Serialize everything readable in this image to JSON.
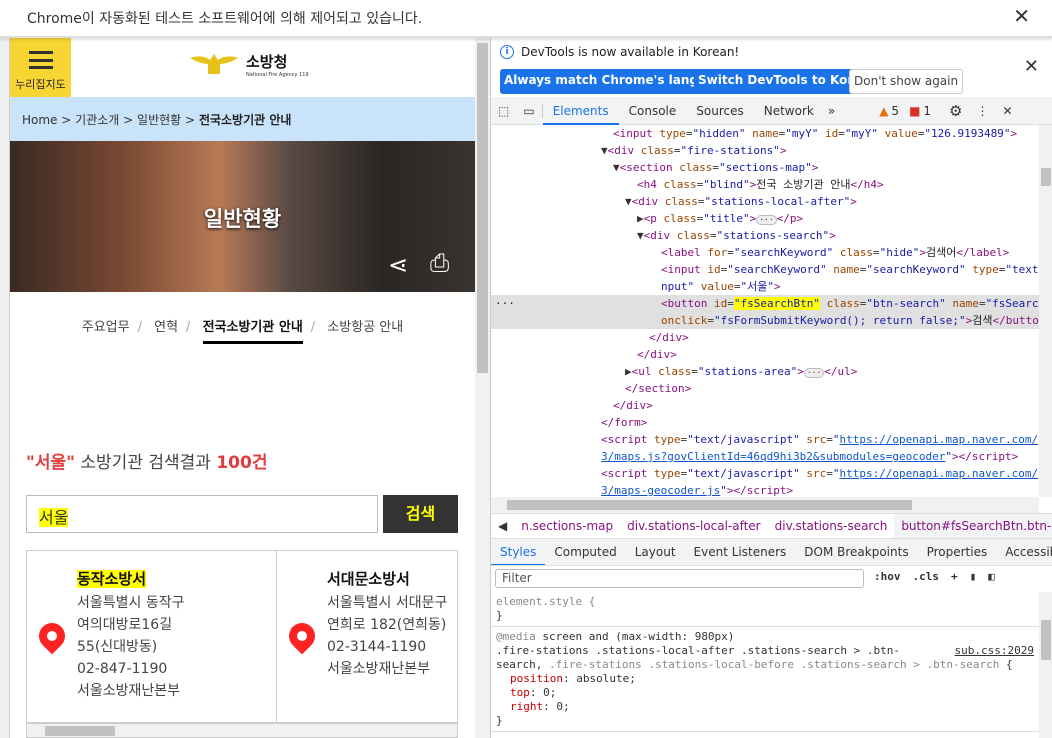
{
  "infobar": {
    "message": "Chrome이 자동화된 테스트 소프트웨어에 의해 제어되고 있습니다.",
    "close": "✕"
  },
  "page": {
    "menu_label": "누리집지도",
    "logo": {
      "name": "소방청",
      "subtitle": "National Fire Agency 119"
    },
    "breadcrumb": {
      "items": [
        "Home",
        "기관소개",
        "일반현황"
      ],
      "current": "전국소방기관 안내",
      "sep": ">"
    },
    "hero_title": "일반현황",
    "subnav": [
      "주요업무",
      "연혁",
      "전국소방기관 안내",
      "소방항공 안내"
    ],
    "result": {
      "query": "\"서울\"",
      "text": "소방기관 검색결과",
      "count": "100건"
    },
    "search": {
      "value": "서울",
      "button": "검색"
    },
    "stations": [
      {
        "name": "동작소방서",
        "lines": [
          "서울특별시 동작구",
          "여의대방로16길",
          "55(신대방동)",
          "02-847-1190",
          "서울소방재난본부"
        ]
      },
      {
        "name": "서대문소방서",
        "lines": [
          "서울특별시 서대문구",
          "연희로 182(연희동)",
          "02-3144-1190",
          "서울소방재난본부"
        ]
      }
    ]
  },
  "devtools": {
    "info": "DevTools is now available in Korean!",
    "buttons": [
      "Always match Chrome's language",
      "Switch DevTools to Korean",
      "Don't show again"
    ],
    "tabs": [
      "Elements",
      "Console",
      "Sources",
      "Network"
    ],
    "warnings": "5",
    "errors": "1",
    "breadcrumbs": [
      "n.sections-map",
      "div.stations-local-after",
      "div.stations-search",
      "button#fsSearchBtn.btn-search"
    ],
    "style_tabs": [
      "Styles",
      "Computed",
      "Layout",
      "Event Listeners",
      "DOM Breakpoints",
      "Properties",
      "Accessibility"
    ],
    "filter_placeholder": "Filter",
    "hov": ":hov",
    "cls": ".cls",
    "rule_source": "sub.css:2029"
  }
}
